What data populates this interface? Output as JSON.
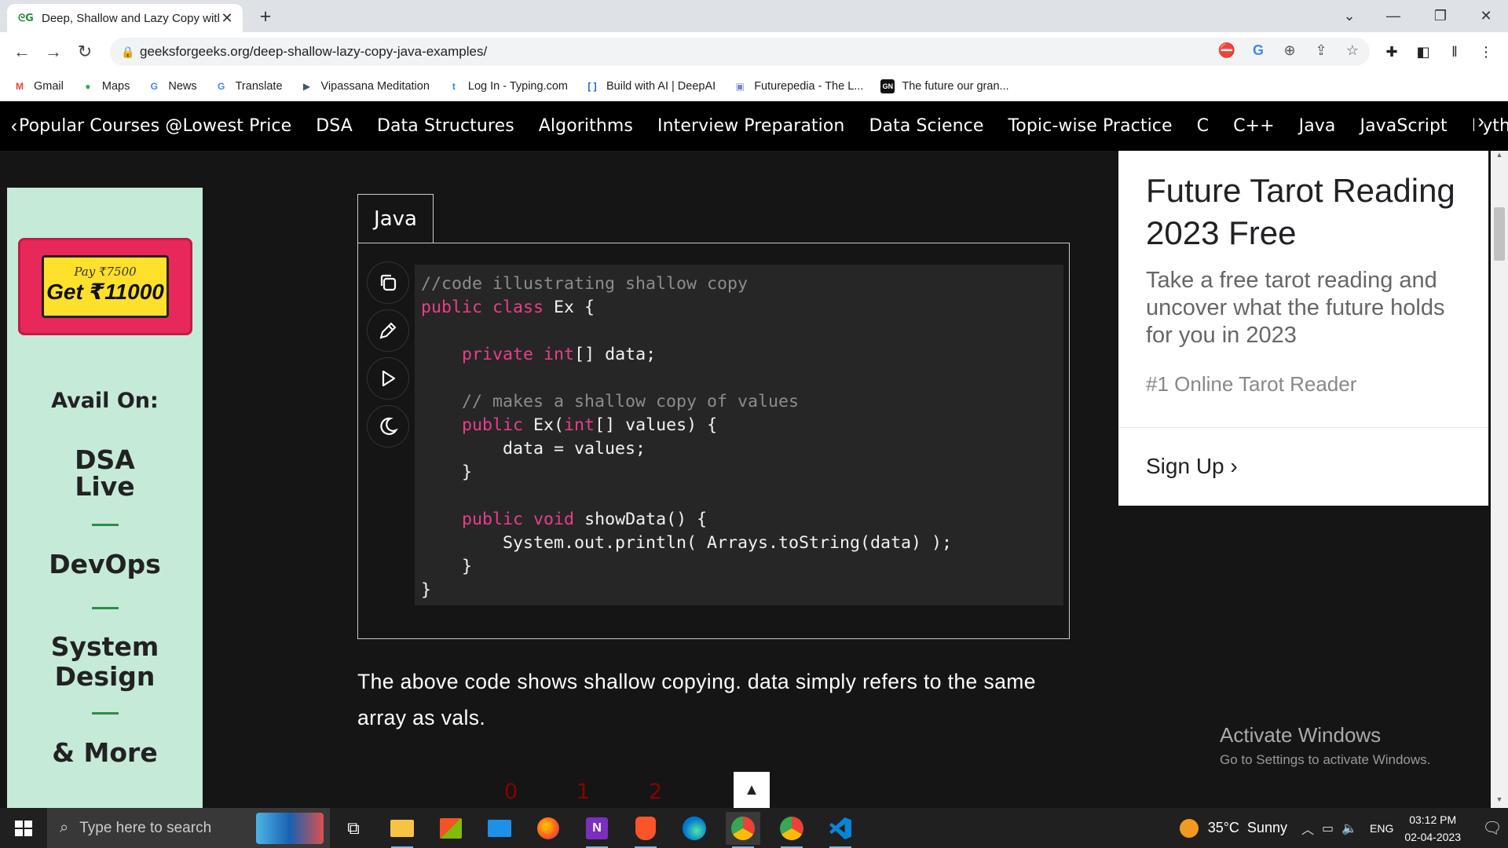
{
  "browser": {
    "tab_title": "Deep, Shallow and Lazy Copy with Java Examples",
    "url": "geeksforgeeks.org/deep-shallow-lazy-copy-java-examples/",
    "bookmarks": [
      {
        "label": "Gmail",
        "icon": "gmail-icon",
        "glyph": "M",
        "color": "#ea4335"
      },
      {
        "label": "Maps",
        "icon": "maps-pin-icon",
        "glyph": "●",
        "color": "#34a853"
      },
      {
        "label": "News",
        "icon": "google-news-icon",
        "glyph": "G",
        "color": "#4285f4"
      },
      {
        "label": "Translate",
        "icon": "translate-icon",
        "glyph": "G",
        "color": "#4285f4"
      },
      {
        "label": "Vipassana Meditation",
        "icon": "vipassana-icon",
        "glyph": "▶",
        "color": "#455a64"
      },
      {
        "label": "Log In - Typing.com",
        "icon": "typing-icon",
        "glyph": "t",
        "color": "#1e88e5"
      },
      {
        "label": "Build with AI | DeepAI",
        "icon": "deepai-icon",
        "glyph": "[ ]",
        "color": "#1565c0"
      },
      {
        "label": "Futurepedia - The L...",
        "icon": "futurepedia-icon",
        "glyph": "▣",
        "color": "#7986cb"
      },
      {
        "label": "The future our gran...",
        "icon": "gn-icon",
        "glyph": "GN",
        "color": "#111111"
      }
    ]
  },
  "site_nav": {
    "items": [
      "Popular Courses @Lowest Price",
      "DSA",
      "Data Structures",
      "Algorithms",
      "Interview Preparation",
      "Data Science",
      "Topic-wise Practice",
      "C",
      "C++",
      "Java",
      "JavaScript",
      "Pyth"
    ]
  },
  "promo": {
    "pay": "Pay ₹7500",
    "get": "Get ₹11000",
    "avail": "Avail On:",
    "dsa": "DSA",
    "live": "Live",
    "devops": "DevOps",
    "system": "System",
    "design": "Design",
    "more": "& More"
  },
  "code": {
    "language_tab": "Java",
    "lines": [
      [
        {
          "t": "//code illustrating shallow copy",
          "c": "cm"
        }
      ],
      [
        {
          "t": "public",
          "c": "kw"
        },
        {
          "t": " "
        },
        {
          "t": "class",
          "c": "kw"
        },
        {
          "t": " Ex {"
        }
      ],
      [
        {
          "t": ""
        }
      ],
      [
        {
          "t": "    "
        },
        {
          "t": "private",
          "c": "kw"
        },
        {
          "t": " "
        },
        {
          "t": "int",
          "c": "kw"
        },
        {
          "t": "[] data;"
        }
      ],
      [
        {
          "t": ""
        }
      ],
      [
        {
          "t": "    "
        },
        {
          "t": "// makes a shallow copy of values",
          "c": "cm"
        }
      ],
      [
        {
          "t": "    "
        },
        {
          "t": "public",
          "c": "kw"
        },
        {
          "t": " Ex("
        },
        {
          "t": "int",
          "c": "kw"
        },
        {
          "t": "[] values) {"
        }
      ],
      [
        {
          "t": "        data = values;"
        }
      ],
      [
        {
          "t": "    }"
        }
      ],
      [
        {
          "t": ""
        }
      ],
      [
        {
          "t": "    "
        },
        {
          "t": "public",
          "c": "kw"
        },
        {
          "t": " "
        },
        {
          "t": "void",
          "c": "kw"
        },
        {
          "t": " showData() {"
        }
      ],
      [
        {
          "t": "        System.out.println( Arrays.toString(data) );"
        }
      ],
      [
        {
          "t": "    }"
        }
      ],
      [
        {
          "t": "}"
        }
      ]
    ]
  },
  "paragraph": "The above code shows shallow copying. data simply refers to the same array as vals.",
  "index_labels": [
    "0",
    "1",
    "2"
  ],
  "back_to_top": "▲",
  "ad": {
    "headline": "Future Tarot Reading 2023 Free",
    "description": "Take a free tarot reading and uncover what the future holds for you in 2023",
    "rating": "#1 Online Tarot Reader",
    "cta": "Sign Up"
  },
  "watermark": {
    "title": "Activate Windows",
    "subtitle": "Go to Settings to activate Windows."
  },
  "taskbar": {
    "search_placeholder": "Type here to search",
    "weather": "35°C  Sunny",
    "lang": "ENG",
    "time": "03:12 PM",
    "date": "02-04-2023"
  }
}
